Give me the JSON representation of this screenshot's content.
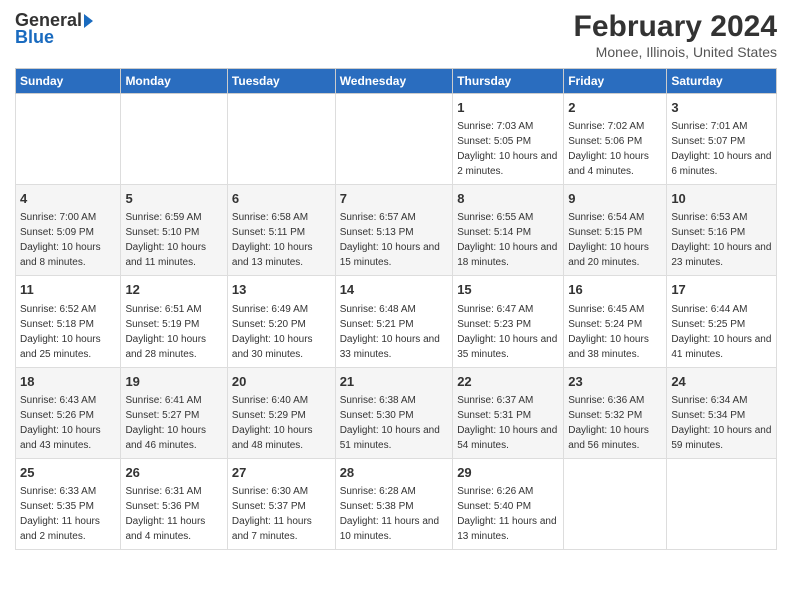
{
  "header": {
    "logo_general": "General",
    "logo_blue": "Blue",
    "title": "February 2024",
    "subtitle": "Monee, Illinois, United States"
  },
  "days_of_week": [
    "Sunday",
    "Monday",
    "Tuesday",
    "Wednesday",
    "Thursday",
    "Friday",
    "Saturday"
  ],
  "weeks": [
    [
      {
        "day": "",
        "info": ""
      },
      {
        "day": "",
        "info": ""
      },
      {
        "day": "",
        "info": ""
      },
      {
        "day": "",
        "info": ""
      },
      {
        "day": "1",
        "info": "Sunrise: 7:03 AM\nSunset: 5:05 PM\nDaylight: 10 hours and 2 minutes."
      },
      {
        "day": "2",
        "info": "Sunrise: 7:02 AM\nSunset: 5:06 PM\nDaylight: 10 hours and 4 minutes."
      },
      {
        "day": "3",
        "info": "Sunrise: 7:01 AM\nSunset: 5:07 PM\nDaylight: 10 hours and 6 minutes."
      }
    ],
    [
      {
        "day": "4",
        "info": "Sunrise: 7:00 AM\nSunset: 5:09 PM\nDaylight: 10 hours and 8 minutes."
      },
      {
        "day": "5",
        "info": "Sunrise: 6:59 AM\nSunset: 5:10 PM\nDaylight: 10 hours and 11 minutes."
      },
      {
        "day": "6",
        "info": "Sunrise: 6:58 AM\nSunset: 5:11 PM\nDaylight: 10 hours and 13 minutes."
      },
      {
        "day": "7",
        "info": "Sunrise: 6:57 AM\nSunset: 5:13 PM\nDaylight: 10 hours and 15 minutes."
      },
      {
        "day": "8",
        "info": "Sunrise: 6:55 AM\nSunset: 5:14 PM\nDaylight: 10 hours and 18 minutes."
      },
      {
        "day": "9",
        "info": "Sunrise: 6:54 AM\nSunset: 5:15 PM\nDaylight: 10 hours and 20 minutes."
      },
      {
        "day": "10",
        "info": "Sunrise: 6:53 AM\nSunset: 5:16 PM\nDaylight: 10 hours and 23 minutes."
      }
    ],
    [
      {
        "day": "11",
        "info": "Sunrise: 6:52 AM\nSunset: 5:18 PM\nDaylight: 10 hours and 25 minutes."
      },
      {
        "day": "12",
        "info": "Sunrise: 6:51 AM\nSunset: 5:19 PM\nDaylight: 10 hours and 28 minutes."
      },
      {
        "day": "13",
        "info": "Sunrise: 6:49 AM\nSunset: 5:20 PM\nDaylight: 10 hours and 30 minutes."
      },
      {
        "day": "14",
        "info": "Sunrise: 6:48 AM\nSunset: 5:21 PM\nDaylight: 10 hours and 33 minutes."
      },
      {
        "day": "15",
        "info": "Sunrise: 6:47 AM\nSunset: 5:23 PM\nDaylight: 10 hours and 35 minutes."
      },
      {
        "day": "16",
        "info": "Sunrise: 6:45 AM\nSunset: 5:24 PM\nDaylight: 10 hours and 38 minutes."
      },
      {
        "day": "17",
        "info": "Sunrise: 6:44 AM\nSunset: 5:25 PM\nDaylight: 10 hours and 41 minutes."
      }
    ],
    [
      {
        "day": "18",
        "info": "Sunrise: 6:43 AM\nSunset: 5:26 PM\nDaylight: 10 hours and 43 minutes."
      },
      {
        "day": "19",
        "info": "Sunrise: 6:41 AM\nSunset: 5:27 PM\nDaylight: 10 hours and 46 minutes."
      },
      {
        "day": "20",
        "info": "Sunrise: 6:40 AM\nSunset: 5:29 PM\nDaylight: 10 hours and 48 minutes."
      },
      {
        "day": "21",
        "info": "Sunrise: 6:38 AM\nSunset: 5:30 PM\nDaylight: 10 hours and 51 minutes."
      },
      {
        "day": "22",
        "info": "Sunrise: 6:37 AM\nSunset: 5:31 PM\nDaylight: 10 hours and 54 minutes."
      },
      {
        "day": "23",
        "info": "Sunrise: 6:36 AM\nSunset: 5:32 PM\nDaylight: 10 hours and 56 minutes."
      },
      {
        "day": "24",
        "info": "Sunrise: 6:34 AM\nSunset: 5:34 PM\nDaylight: 10 hours and 59 minutes."
      }
    ],
    [
      {
        "day": "25",
        "info": "Sunrise: 6:33 AM\nSunset: 5:35 PM\nDaylight: 11 hours and 2 minutes."
      },
      {
        "day": "26",
        "info": "Sunrise: 6:31 AM\nSunset: 5:36 PM\nDaylight: 11 hours and 4 minutes."
      },
      {
        "day": "27",
        "info": "Sunrise: 6:30 AM\nSunset: 5:37 PM\nDaylight: 11 hours and 7 minutes."
      },
      {
        "day": "28",
        "info": "Sunrise: 6:28 AM\nSunset: 5:38 PM\nDaylight: 11 hours and 10 minutes."
      },
      {
        "day": "29",
        "info": "Sunrise: 6:26 AM\nSunset: 5:40 PM\nDaylight: 11 hours and 13 minutes."
      },
      {
        "day": "",
        "info": ""
      },
      {
        "day": "",
        "info": ""
      }
    ]
  ]
}
